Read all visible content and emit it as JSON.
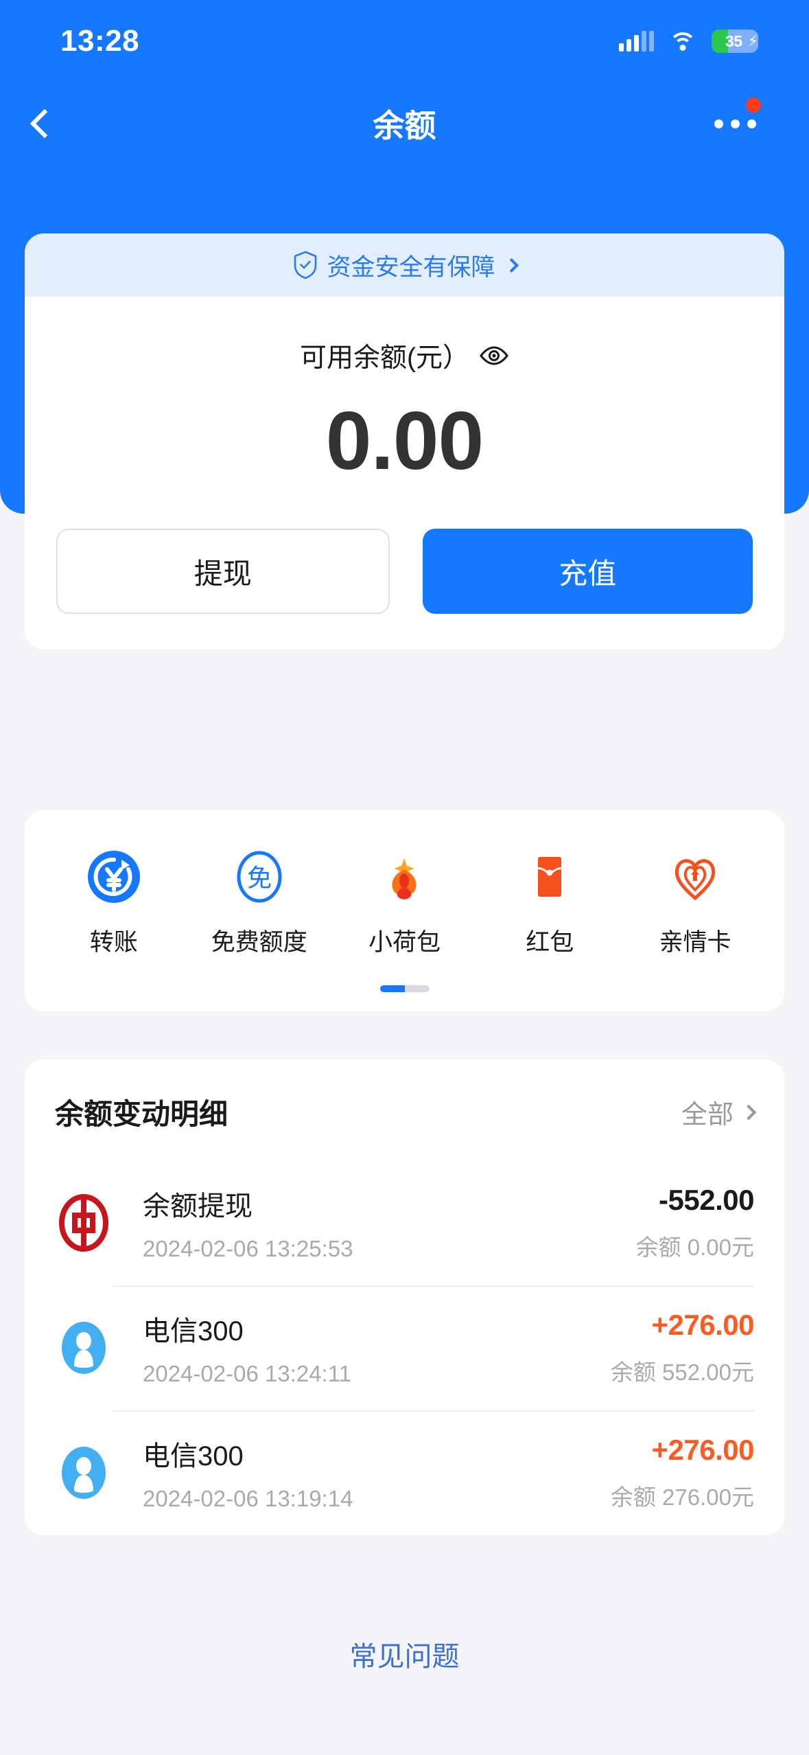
{
  "status_bar": {
    "time": "13:28",
    "battery_percent": "35",
    "battery_charging_icon": "bolt-icon",
    "signal_icon": "signal-bars-icon",
    "wifi_icon": "wifi-icon"
  },
  "nav": {
    "title": "余额",
    "back_icon": "back-chevron-icon",
    "more_icon": "more-dots-icon",
    "has_notification_badge": true
  },
  "balance_card": {
    "security_banner": {
      "text": "资金安全有保障",
      "icon": "shield-check-icon",
      "arrow_icon": "chevron-right-icon"
    },
    "label": "可用余额(元）",
    "eye_icon": "eye-icon",
    "amount": "0.00",
    "buttons": {
      "withdraw": "提现",
      "topup": "充值"
    }
  },
  "quick_actions": {
    "items": [
      {
        "label": "转账",
        "icon": "yuan-transfer-icon"
      },
      {
        "label": "免费额度",
        "icon": "free-quota-icon"
      },
      {
        "label": "小荷包",
        "icon": "lotus-pocket-icon"
      },
      {
        "label": "红包",
        "icon": "red-envelope-icon"
      },
      {
        "label": "亲情卡",
        "icon": "family-heart-card-icon"
      }
    ],
    "pager": {
      "pages": 2,
      "active": 1
    }
  },
  "transactions": {
    "title": "余额变动明细",
    "all_label": "全部",
    "all_arrow_icon": "chevron-right-icon",
    "rows": [
      {
        "avatar_icon": "bank-of-china-icon",
        "name": "余额提现",
        "time": "2024-02-06 13:25:53",
        "amount": "-552.00",
        "sign": "negative",
        "balance_after": "余额 0.00元"
      },
      {
        "avatar_icon": "person-avatar-icon",
        "name": "电信300",
        "time": "2024-02-06 13:24:11",
        "amount": "+276.00",
        "sign": "positive",
        "balance_after": "余额 552.00元"
      },
      {
        "avatar_icon": "person-avatar-icon",
        "name": "电信300",
        "time": "2024-02-06 13:19:14",
        "amount": "+276.00",
        "sign": "positive",
        "balance_after": "余额 276.00元"
      }
    ]
  },
  "faq": {
    "label": "常见问题"
  },
  "colors": {
    "brand_blue": "#1677ff",
    "banner_blue_bg": "#e3eefd",
    "accent_orange": "#ff5a1f",
    "battery_green": "#2cc84c",
    "badge_red": "#ff3b1f",
    "page_bg": "#f5f5f7"
  }
}
